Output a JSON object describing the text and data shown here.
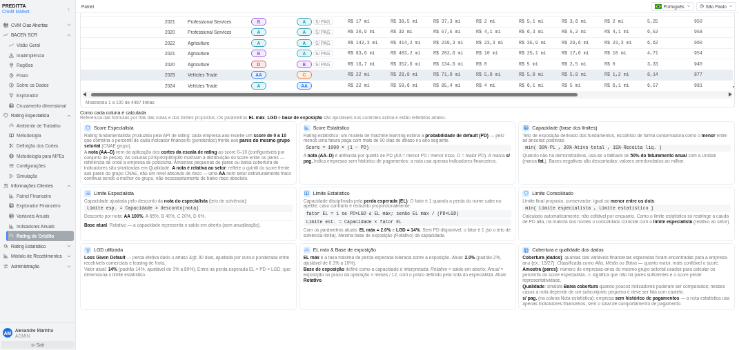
{
  "sidebar": {
    "brand": "PREDITTA",
    "subtitle": "Credit Market",
    "groups": [
      {
        "label": "CVM Cias Abertas",
        "expanded": false
      },
      {
        "label": "BACEN SCR",
        "expanded": true,
        "children": [
          {
            "label": "Visão Geral",
            "selected": false
          },
          {
            "label": "Inadimplência",
            "selected": false
          },
          {
            "label": "Regiões",
            "selected": false
          },
          {
            "label": "Prazo",
            "selected": false
          },
          {
            "label": "Sobre os Dados",
            "selected": false
          },
          {
            "label": "Explorador",
            "selected": false
          },
          {
            "label": "Cruzamento dimensional",
            "selected": false
          }
        ]
      },
      {
        "label": "Rating Especialista",
        "expanded": true,
        "children": [
          {
            "label": "Ambiente de Trabalho",
            "selected": false
          },
          {
            "label": "Metodologia",
            "selected": false
          },
          {
            "label": "Definição dos Cortes",
            "selected": false
          },
          {
            "label": "Metodologia para MPEs",
            "selected": false
          },
          {
            "label": "Configurações",
            "selected": false
          },
          {
            "label": "Simulação",
            "selected": false
          }
        ]
      },
      {
        "label": "Informações Clientes",
        "expanded": true,
        "children": [
          {
            "label": "Painel Financeiro",
            "selected": false
          },
          {
            "label": "Explorador Financeiro",
            "selected": false
          },
          {
            "label": "Variáveis Anuais",
            "selected": false
          },
          {
            "label": "Indicadores Anuais",
            "selected": false
          },
          {
            "label": "Rating de Crédito",
            "selected": true
          }
        ]
      },
      {
        "label": "Rating Estatístico",
        "expanded": false
      },
      {
        "label": "Módulo de Recebimentos",
        "expanded": false
      },
      {
        "label": "Administração",
        "expanded": false
      }
    ],
    "user": {
      "initials": "AM",
      "name": "Alexandre Marinho",
      "role": "ADMIN"
    },
    "logout": "Sair"
  },
  "header": {
    "title": "Painel",
    "language": "Português",
    "timezone": "São Paulo"
  },
  "table": {
    "rows": [
      {
        "highlighted": false,
        "cells": [
          "2021",
          "Professional Services",
          {
            "text": "B",
            "color": "#9b5de5"
          },
          {
            "text": "A",
            "color": "#2fa4b9",
            "tag": "S/ PAG."
          },
          "R$ 17 mi",
          "R$ 38,5 mi",
          "R$ 37,3 mi",
          "R$ 2 mi",
          "R$ 5,1 mi",
          "R$ 3,6 mi",
          "R$ 2 mi",
          "5,25",
          "950"
        ]
      },
      {
        "highlighted": false,
        "cells": [
          "2020",
          "Professional Services",
          {
            "text": "A",
            "color": "#2fa4b9"
          },
          {
            "text": "A",
            "color": "#2fa4b9",
            "tag": "S/ PAG."
          },
          "R$ 20,9 mi",
          "R$ 39 mi",
          "R$ 57,5 mi",
          "R$ 4,1 mi",
          "R$ 6,3 mi",
          "R$ 5,2 mi",
          "R$ 4,1 mi",
          "6,52",
          "958"
        ]
      },
      {
        "highlighted": false,
        "cells": [
          "2022",
          "Agriculture",
          {
            "text": "A",
            "color": "#2fa4b9"
          },
          {
            "text": "A",
            "color": "#2fa4b9",
            "tag": "S/ PAG."
          },
          "R$ 142,3 mi",
          "R$ 414,2 mi",
          "R$ 239,3 mi",
          "R$ 23,3 mi",
          "R$ 35,9 mi",
          "R$ 29,6 mi",
          "R$ 23,3 mi",
          "6,62",
          "960"
        ]
      },
      {
        "highlighted": false,
        "cells": [
          "2021",
          "Agriculture",
          {
            "text": "B",
            "color": "#9b5de5"
          },
          {
            "text": "A",
            "color": "#2fa4b9",
            "tag": "S/ PAG."
          },
          "R$ 83,6 mi",
          "R$ 403,2 mi",
          "R$ 202,6 mi",
          "R$ 10 mi",
          "R$ 25,1 mi",
          "R$ 17,6 mi",
          "R$ 10 mi",
          "4,71",
          "954"
        ]
      },
      {
        "highlighted": false,
        "cells": [
          "2020",
          "Agriculture",
          {
            "text": "D",
            "color": "#e5484d"
          },
          {
            "text": "B",
            "color": "#9b5de5",
            "tag": "S/ PAG."
          },
          "R$ 16,7 mi",
          "R$ 352,6 mi",
          "R$ 134,6 mi",
          "R$ 0",
          "R$ 5 mi",
          "R$ 2,5 mi",
          "R$ 0",
          "3,33",
          "940"
        ]
      },
      {
        "highlighted": true,
        "cells": [
          "2025",
          "Vehicles Trade",
          {
            "text": "AA",
            "color": "#3b82f6"
          },
          {
            "text": "C",
            "color": "#ea7a2f"
          },
          "R$ 22 mi",
          "R$ 28,8 mi",
          "R$ 71,9 mi",
          "R$ 5,8 mi",
          "R$ 5,8 mi",
          "R$ 5,8 mi",
          "R$ 1,2 mi",
          "8,14",
          "877"
        ]
      },
      {
        "highlighted": false,
        "cells": [
          "2024",
          "Vehicles Trade",
          {
            "text": "A",
            "color": "#2fa4b9"
          },
          {
            "text": "AA",
            "color": "#3b82f6"
          },
          "R$ 22 mi",
          "R$ 58,6 mi",
          "R$ 85,4 mi",
          "R$ 4 mi",
          "R$ 6,1 mi",
          "R$ 5 mi",
          "R$ 6,1 mi",
          "6,57",
          "981"
        ]
      }
    ],
    "footer": "Mostrando 1 a 100 de 4467 linhas"
  },
  "explainer": {
    "title": "Como cada coluna é calculada",
    "description": "Referência das fórmulas por trás das notas e dos limites propostos. Os parâmetros **EL máx**, **LGD** e **base de exposição** são ajustáveis nos controles acima e estão refletidos abaixo.",
    "cards": [
      {
        "title": "Score Especialista",
        "blocks": [
          {
            "kind": "text",
            "text": "Rating fundamentalista produzido pela API de rating: cada empresa-ano recebe um **score de 0 a 10** que combina o percentil de cada indicador financeiro (ponderado) frente aos **pares do mesmo grupo setorial** (CNAE grupo)."
          },
          {
            "kind": "text",
            "text": "A **nota (AA–D)** vem da aplicação dos **cortes da escala de rating** ao score 0–10 (configuráveis por conjunto de pesos). As colunas p20/p40/p60/p80 mostram a distribuição do score entre os pares — referência de onde a empresa se posiciona. Amostras pequenas de pares ou baixa cobertura de indicadores são sinalizadas em Qualidade. **A nota é relativa ao setor**: reflete o quintil do score frente aos pares do grupo CNAE, não um nível absoluto de risco — uma **AA** num setor estruturalmente fraco continua sendo a melhor do grupo, não necessariamente de baixo risco absoluto."
          }
        ]
      },
      {
        "title": "Score Estatístico",
        "blocks": [
          {
            "kind": "text",
            "text": "Rating estatístico: um modelo de machine learning estima a **probabilidade de default (PD)** — pelo menos uma fatura paga com mais de 90 dias de atraso no ano seguinte."
          },
          {
            "kind": "code",
            "text": "Score = 1000 × (1 − PD)"
          },
          {
            "kind": "text",
            "text": "A **nota (AA–D)** é atribuída por quintis de PD (AA = menor PD / menor risco, D = maior PD). A marca **s/ pag.** indica empresas sem histórico de pagamentos: a nota usa apenas indicadores financeiros."
          }
        ]
      },
      {
        "title": "Capacidade (base dos limites)",
        "blocks": [
          {
            "kind": "text",
            "text": "Teto de exposição derivado dos fundamentos, escolhido de forma conservadora como o **menor** entre as âncoras positivas:"
          },
          {
            "kind": "code",
            "text": "mín( 30%·PL , 20%·Ativo total , 15%·Receita líq. )"
          },
          {
            "kind": "text",
            "text": "Quando não há demonstrativos, usa-se o fallback de **50% do faturamento anual** com a Unidas (marca **fat.**). Bases negativas são descartadas; valores arredondados ao milhar."
          }
        ]
      },
      {
        "title": "Limite Especialista",
        "blocks": [
          {
            "kind": "text",
            "text": "Capacidade ajustada pelo desconto da **nota do especialista** (teto de solvência):"
          },
          {
            "kind": "code",
            "text": "Limite esp. = Capacidade × desconto(nota)"
          },
          {
            "kind": "text",
            "text": "Desconto por nota: **AA 100%**, A 65%, B 40%, C 20%, D 0%."
          },
          {
            "kind": "divider"
          },
          {
            "kind": "text",
            "text": "**Base atual**: Rotativo — a capacidade representa o saldo em aberto (sem anualização)."
          }
        ]
      },
      {
        "title": "Limite Estatístico",
        "blocks": [
          {
            "kind": "text",
            "text": "Capacidade disciplinada pela **perda esperada (EL)**: O fator é 1 quando a perda do nome cabe no apetite; caso contrário é reduzido proporcionalmente:"
          },
          {
            "kind": "code",
            "text": "fator EL = 1 se PD×LGD ≤ EL máx; senão EL máx / (PD×LGD)"
          },
          {
            "kind": "code",
            "text": "Limite est. = Capacidade × fator EL"
          },
          {
            "kind": "text",
            "text": "Com os parâmetros atuais: **EL máx = 2.0%** e **LGD = 14%**. Sem PD disponível, o fator é 1 (só o teto de solvência limita). Mesma base de exposição (Rotativo) da capacidade."
          }
        ]
      },
      {
        "title": "Limite Consolidado",
        "blocks": [
          {
            "kind": "text",
            "text": "Limite final proposto, conservador: igual ao **menor entre os dois**:"
          },
          {
            "kind": "code",
            "text": "mín( Limite especialista , Limite estatístico )"
          },
          {
            "kind": "text",
            "text": "Calculado automaticamente; não editável por enquanto. Como o limite estatístico só restringe a cauda de PD alta, na maioria dos nomes o consolidado coincide com o **limite especialista** (relativo ao setor)."
          }
        ]
      },
      {
        "title": "LGD utilizada",
        "blocks": [
          {
            "kind": "text",
            "text": "**Loss Given Default** — perda efetiva dado o atraso &gt; 90 dias, ajustada por cura e ponderada entre recebíveis comerciais e leasing de frota."
          },
          {
            "kind": "text",
            "text": "Valor atual: **14%** (padrão 14%, ajustável de 1% a 80%). Entra na perda esperada EL = PD × LGD, que dimensiona o limite estatístico."
          }
        ]
      },
      {
        "title": "EL máx & Base de exposição",
        "blocks": [
          {
            "kind": "text",
            "text": "**EL máx** é a taxa máxima de perda esperada tolerada sobre a exposição. Atual: **2.0%** (padrão 2%, ajustável de 0.1% a 10%)."
          },
          {
            "kind": "text",
            "text": "**Base de exposição** define como a capacidade é interpretada: *Rotativo* = saldo em aberto; *Anual* = exposição no prazo da operação × meses / 12, com o prazo definido pela nota do especialista. Atual: **Rotativo**."
          }
        ]
      },
      {
        "title": "Cobertura e qualidade dos dados",
        "blocks": [
          {
            "kind": "text",
            "text": "**Cobertura (dados)**: quantas das variáveis financeiras esperadas foram encontradas para a empresa-ano (ex.: 15/27). Classificada como *Alta*, *Média* ou *Baixa* — quanto maior, mais confiável o score."
          },
          {
            "kind": "text",
            "text": "**Amostra (pares)**: número de empresas-anos do mesmo grupo setorial usados para calcular os percentis do score especialista. ⚠ significa que não há pares suficientes e o score perde representatividade."
          },
          {
            "kind": "text",
            "text": "**Qualidade**: sinaliza **Baixa cobertura** quando poucos indicadores puderam ser comparados; nesses casos a nota depende de um subconjunto pequeno e deve ser lida com cautela."
          },
          {
            "kind": "text",
            "text": "**s/ pag.** (na coluna Nota estatística): empresa **sem histórico de pagamentos** — a nota estatística usa apenas indicadores financeiros, sem o sinal de comportamento de pagamento."
          }
        ]
      }
    ]
  }
}
